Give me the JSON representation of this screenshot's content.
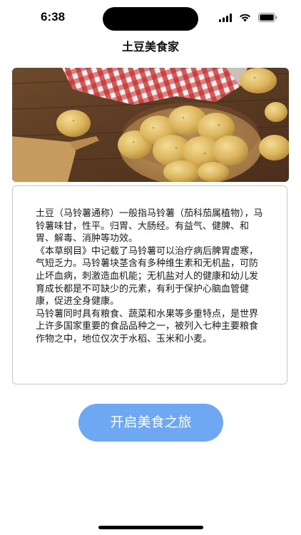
{
  "status_bar": {
    "time": "6:38",
    "icons": [
      "signal-icon",
      "wifi-icon",
      "battery-icon"
    ]
  },
  "nav": {
    "title": "土豆美食家"
  },
  "hero_image": {
    "subject": "potato-basket-image"
  },
  "description": {
    "text": "土豆（马铃薯通称）一般指马铃薯（茄科茄属植物），马铃薯味甘，性平。归胃、大肠经。有益气、健脾、和胃、解毒、消肿等功效。\n《本草纲目》中记载了马铃薯可以治疗病后脾胃虚寒，气短乏力。马铃薯块茎含有多种维生素和无机盐，可防止坏血病，刺激造血机能；无机盐对人的健康和幼儿发育成长都是不可缺少的元素，有利于保护心脑血管健康，促进全身健康。\n马铃薯同时具有粮食、蔬菜和水果等多重特点，是世界上许多国家重要的食品品种之一，被列入七种主要粮食作物之中，地位仅次于水稻、玉米和小麦。"
  },
  "actions": {
    "start_label": "开启美食之旅"
  },
  "colors": {
    "button": "#6ea7f2",
    "card_border": "#c8c8c8"
  }
}
